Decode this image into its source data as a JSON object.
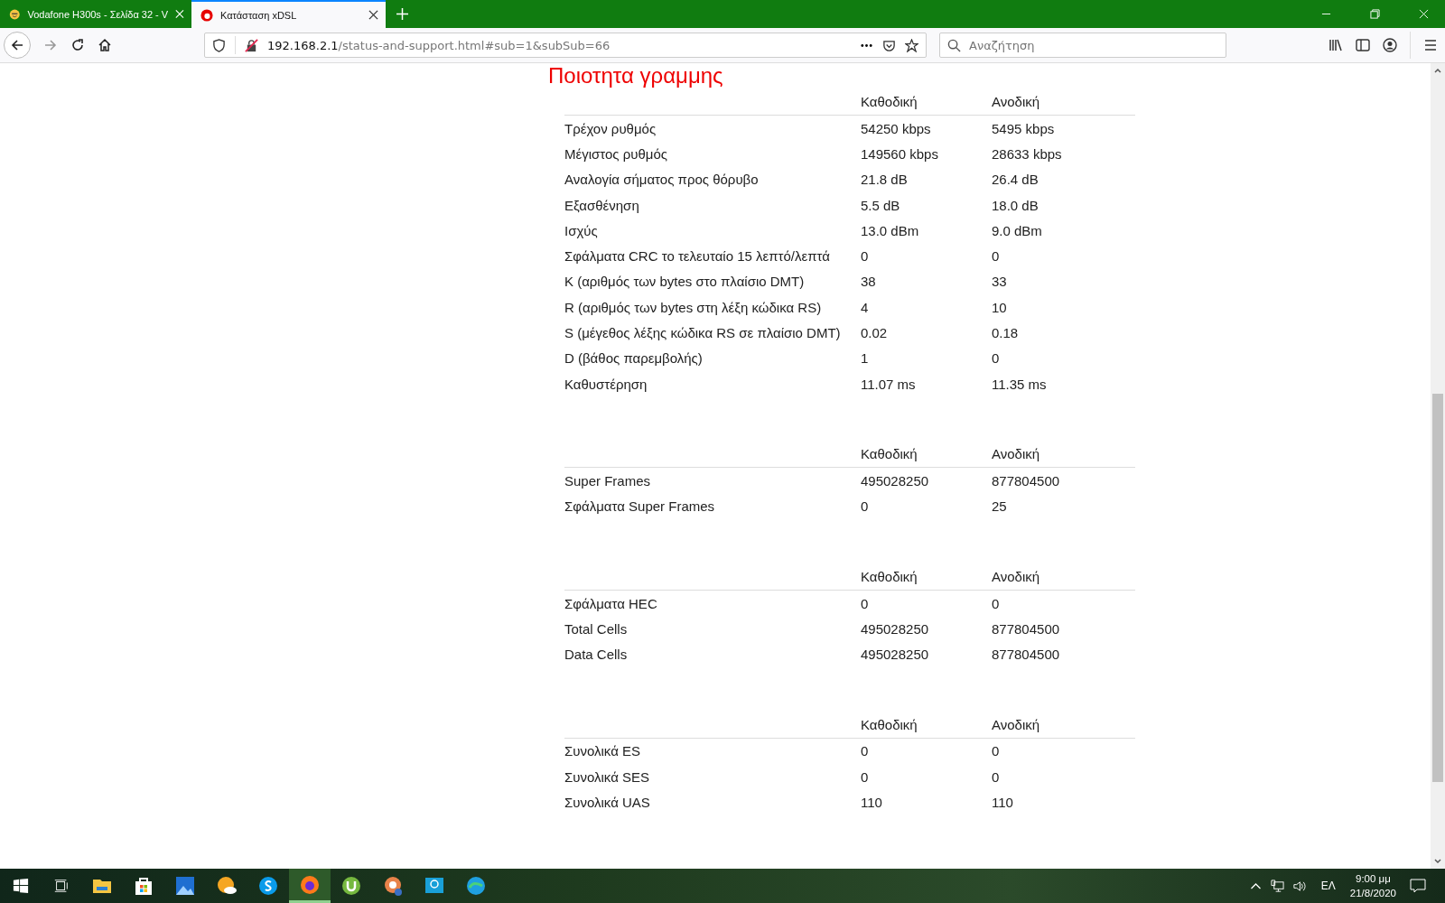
{
  "tabs": [
    {
      "title": "Vodafone H300s - Σελίδα 32 - V",
      "selected": false,
      "kind": "smiley"
    },
    {
      "title": "Κατάσταση xDSL",
      "selected": true,
      "kind": "brand"
    }
  ],
  "address_bar": {
    "host": "192.168.2.1",
    "path": "/status-and-support.html#sub=1&subSub=66"
  },
  "search": {
    "placeholder": "Αναζήτηση"
  },
  "heading": "Ποιοτητα γραμμης",
  "tables": [
    {
      "columns": [
        "Καθοδική",
        "Ανοδική"
      ],
      "rows": [
        {
          "label": "Τρέχον ρυθμός",
          "down": "54250 kbps",
          "up": "5495 kbps"
        },
        {
          "label": "Μέγιστος ρυθμός",
          "down": "149560 kbps",
          "up": "28633 kbps"
        },
        {
          "label": "Αναλογία σήματος προς θόρυβο",
          "down": "21.8 dB",
          "up": "26.4 dB"
        },
        {
          "label": "Εξασθένηση",
          "down": "5.5 dB",
          "up": "18.0 dB"
        },
        {
          "label": "Ισχύς",
          "down": "13.0 dBm",
          "up": "9.0 dBm"
        },
        {
          "label": "Σφάλματα CRC το τελευταίο 15 λεπτό/λεπτά",
          "down": "0",
          "up": "0"
        },
        {
          "label": "K (αριθμός των bytes στο πλαίσιο DMT)",
          "down": "38",
          "up": "33"
        },
        {
          "label": "R (αριθμός των bytes στη λέξη κώδικα RS)",
          "down": "4",
          "up": "10"
        },
        {
          "label": "S (μέγεθος λέξης κώδικα RS σε πλαίσιο DMT)",
          "down": "0.02",
          "up": "0.18"
        },
        {
          "label": "D (βάθος παρεμβολής)",
          "down": "1",
          "up": "0"
        },
        {
          "label": "Καθυστέρηση",
          "down": "11.07 ms",
          "up": "11.35 ms"
        }
      ]
    },
    {
      "columns": [
        "Καθοδική",
        "Ανοδική"
      ],
      "rows": [
        {
          "label": "Super Frames",
          "down": "495028250",
          "up": "877804500"
        },
        {
          "label": "Σφάλματα Super Frames",
          "down": "0",
          "up": "25"
        }
      ]
    },
    {
      "columns": [
        "Καθοδική",
        "Ανοδική"
      ],
      "rows": [
        {
          "label": "Σφάλματα HEC",
          "down": "0",
          "up": "0"
        },
        {
          "label": "Total Cells",
          "down": "495028250",
          "up": "877804500"
        },
        {
          "label": "Data Cells",
          "down": "495028250",
          "up": "877804500"
        }
      ]
    },
    {
      "columns": [
        "Καθοδική",
        "Ανοδική"
      ],
      "rows": [
        {
          "label": "Συνολικά ES",
          "down": "0",
          "up": "0"
        },
        {
          "label": "Συνολικά SES",
          "down": "0",
          "up": "0"
        },
        {
          "label": "Συνολικά UAS",
          "down": "110",
          "up": "110"
        }
      ]
    }
  ],
  "taskbar": {
    "apps": [
      {
        "kind": "folder",
        "selected": false
      },
      {
        "kind": "bag",
        "selected": false
      },
      {
        "kind": "picture",
        "selected": false
      },
      {
        "kind": "weather",
        "selected": false
      },
      {
        "kind": "letter",
        "selected": false
      },
      {
        "kind": "browser",
        "selected": true
      },
      {
        "kind": "torrent",
        "selected": false
      },
      {
        "kind": "globe",
        "selected": false
      },
      {
        "kind": "monitor",
        "selected": false
      },
      {
        "kind": "wave",
        "selected": false
      }
    ],
    "language": "ΕΛ",
    "time": "9:00 μμ",
    "date": "21/8/2020"
  }
}
